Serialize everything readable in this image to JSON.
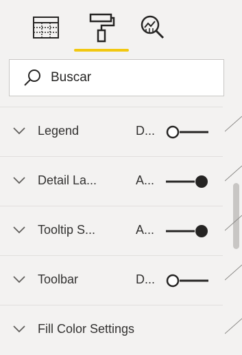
{
  "tabs": [
    {
      "name": "fields",
      "icon": "table-icon"
    },
    {
      "name": "format",
      "icon": "paint-roller-icon",
      "active": true
    },
    {
      "name": "analytics",
      "icon": "analytics-magnifier-icon"
    }
  ],
  "search": {
    "value": "Buscar",
    "icon": "search-icon"
  },
  "sections": [
    {
      "label": "Legend",
      "value": "D...",
      "toggle": "off"
    },
    {
      "label": "Detail La...",
      "value": "A...",
      "toggle": "on"
    },
    {
      "label": "Tooltip S...",
      "value": "A...",
      "toggle": "on"
    },
    {
      "label": "Toolbar",
      "value": "D...",
      "toggle": "off"
    },
    {
      "label": "Fill Color Settings",
      "value": "",
      "toggle": null
    }
  ],
  "colors": {
    "accent": "#f2c811",
    "toggle": "#252423",
    "border": "#e1dfdd"
  }
}
